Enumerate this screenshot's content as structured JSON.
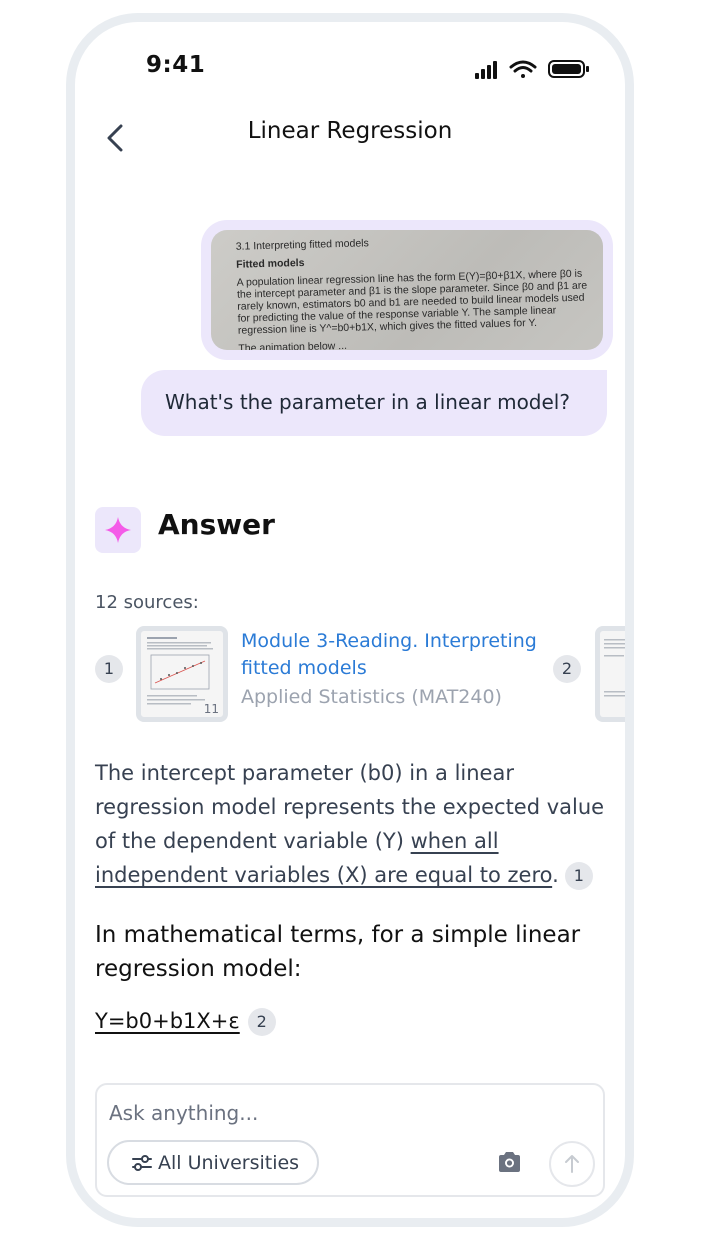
{
  "status_bar": {
    "time": "9:41"
  },
  "header": {
    "title": "Linear Regression"
  },
  "photo": {
    "heading": "3.1 Interpreting fitted models",
    "subheading": "Fitted models",
    "body": "A population linear regression line has the form E(Y)=β0+β1X, where β0 is the intercept parameter and β1 is the slope parameter. Since β0 and β1 are rarely known, estimators b0 and b1 are needed to build linear models used for predicting the value of the response variable Y. The sample linear regression line is Y^=b0+b1X, which gives the fitted values for Y.",
    "cut_line": "The animation below ..."
  },
  "question": "What's the parameter in a linear model?",
  "answer": {
    "title": "Answer",
    "sources_label": "12 sources:",
    "sources": [
      {
        "index": "1",
        "title": "Module 3-Reading. Interpreting fitted models",
        "subtitle": "Applied Statistics (MAT240)",
        "page_count": "11"
      },
      {
        "index": "2"
      }
    ],
    "paragraph_plain": "The intercept parameter (b0) in a linear regression model represents the expected value of the dependent variable (Y) ",
    "paragraph_link": "when all independent variables (X) are equal to zero",
    "paragraph_end": ".",
    "paragraph_cite": "1",
    "heading": "In mathematical terms, for a simple linear regression model:",
    "formula": "Y=b0+b1X+ε",
    "formula_cite": "2"
  },
  "composer": {
    "placeholder": "Ask anything...",
    "filter_label": "All Universities"
  },
  "colors": {
    "accent": "#ece7fb",
    "link": "#2b7bd6",
    "sparkle": "#f45be8"
  }
}
